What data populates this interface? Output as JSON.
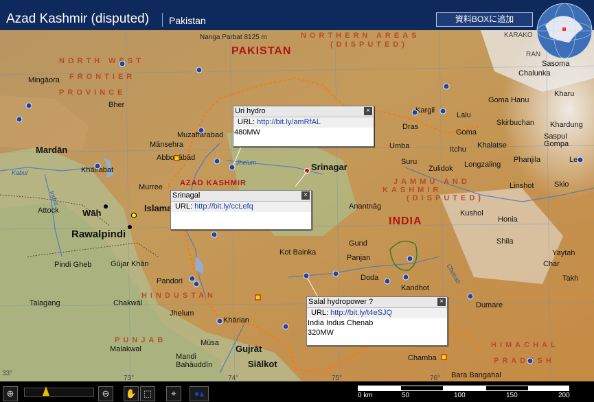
{
  "header": {
    "title": "Azad Kashmir (disputed)",
    "subtitle": "Pakistan",
    "add_button": "資料BOXに追加"
  },
  "map": {
    "countries": [
      "PAKISTAN",
      "INDIA"
    ],
    "regions": [
      "NORTH WEST",
      "FRONTIER",
      "PROVINCE",
      "NORTHERN AREAS",
      "(DISPUTED)",
      "AZAD KASHMIR",
      "JAMMU AND",
      "KASHMIR",
      "(DISPUTED)",
      "HINDUSTAN",
      "PUNJAB",
      "HIMACHAL",
      "PRADESH"
    ],
    "peak": "Nanga Parbat 8125 m",
    "rivers": [
      "Kabul",
      "Indus",
      "Jhelum",
      "Chenab"
    ],
    "places": [
      "Mingāora",
      "Bher",
      "Mardān",
      "Mānsehra",
      "Abbottābād",
      "Muzaffarabad",
      "Khairabat",
      "Murree",
      "Islamabad",
      "Attock",
      "Wāh",
      "Rawalpindi",
      "Pindi Gheb",
      "Gūjar Khān",
      "Talagang",
      "Chakwāl",
      "Pandori",
      "Jhelum",
      "Khārian",
      "Mūsa",
      "Gujrāt",
      "Malakwal",
      "Mandi Bahāuddīn",
      "Siālkot",
      "Srinagar",
      "Anantnāg",
      "Kot Bainka",
      "Gund",
      "Panjan",
      "Doda",
      "Kandhot",
      "Dras",
      "Kargil",
      "Umba",
      "Suru",
      "Zulidok",
      "Itchu",
      "Lalu",
      "Goma",
      "Goma Hanu",
      "Khalatse",
      "Skirbuchan",
      "Longzaling",
      "Phanjila",
      "Linshot",
      "Skio",
      "Kushol",
      "Honia",
      "Shila",
      "Yaytah",
      "Char",
      "Takh",
      "Dumare",
      "Chamba",
      "Bara Bangahal",
      "Chalunka",
      "Sasoma",
      "Kharu",
      "Khardung",
      "Saspul",
      "Gompa",
      "Le"
    ],
    "edge_labels": [
      "KARAKO",
      "RAN",
      "73°",
      "74°",
      "75°",
      "76°",
      "33°"
    ]
  },
  "popups": [
    {
      "title": "Uri hydro",
      "url_label": "URL:",
      "url": "http://bit.ly/amRfAL",
      "body": [
        "480MW"
      ]
    },
    {
      "title": "Srinagal",
      "url_label": "URL:",
      "url": "http://bit.ly/ccLefq",
      "body": []
    },
    {
      "title": "Salal hydropower ?",
      "url_label": "URL:",
      "url": "http://bit.ly/t4eSJQ",
      "body": [
        "India Indus Chenab",
        "320MW"
      ]
    }
  ],
  "scale": {
    "ticks": [
      "0 km",
      "50",
      "100",
      "150",
      "200"
    ]
  },
  "colors": {
    "header_bg": "#0e2a5c",
    "popup_link": "#1b3ea6",
    "country_label": "#b01515",
    "region_label": "#b84b2a",
    "border_line": "#f07f1a"
  }
}
